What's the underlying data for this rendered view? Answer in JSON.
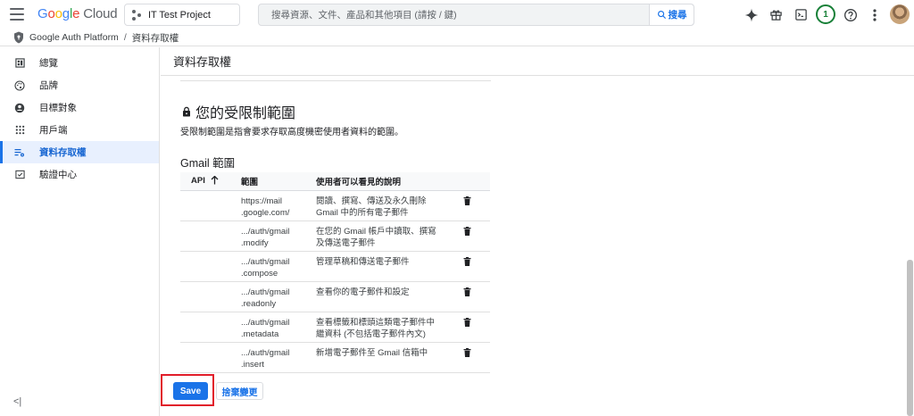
{
  "header": {
    "logo_google": [
      "G",
      "o",
      "o",
      "g",
      "l",
      "e"
    ],
    "logo_cloud": "Cloud",
    "project_name": "IT Test Project",
    "search_placeholder": "搜尋資源、文件、產品和其他項目 (請按 / 鍵)",
    "search_button": "搜尋",
    "notification_count": "1",
    "icons": [
      "menu-icon",
      "gemini-icon",
      "gift-icon",
      "cloud-shell-icon",
      "help-icon",
      "more-vert-icon"
    ]
  },
  "breadcrumb": {
    "root": "Google Auth Platform",
    "separator": "/",
    "current": "資料存取權"
  },
  "sidebar": {
    "items": [
      {
        "label": "總覽",
        "icon": "dashboard-icon"
      },
      {
        "label": "品牌",
        "icon": "palette-icon"
      },
      {
        "label": "目標對象",
        "icon": "account-circle-icon"
      },
      {
        "label": "用戶端",
        "icon": "grid-icon"
      },
      {
        "label": "資料存取權",
        "icon": "data-access-icon",
        "active": true
      },
      {
        "label": "驗證中心",
        "icon": "verify-icon"
      }
    ],
    "collapse": "<|"
  },
  "main": {
    "page_title": "資料存取權",
    "section_title": "您的受限制範圍",
    "section_desc": "受限制範圍是指會要求存取高度機密使用者資料的範圍。",
    "gmail_title": "Gmail 範圍",
    "table": {
      "headers": {
        "api": "API",
        "scope": "範圍",
        "desc": "使用者可以看見的說明"
      },
      "rows": [
        {
          "scope1": "https://mail",
          "scope2": ".google.com/",
          "desc1": "閱讀、撰寫、傳送及永久刪除",
          "desc2": "Gmail 中的所有電子郵件"
        },
        {
          "scope1": ".../auth/gmail",
          "scope2": ".modify",
          "desc1": "在您的 Gmail 帳戶中讀取、撰寫",
          "desc2": "及傳送電子郵件"
        },
        {
          "scope1": ".../auth/gmail",
          "scope2": ".compose",
          "desc1": "管理草稿和傳送電子郵件",
          "desc2": ""
        },
        {
          "scope1": ".../auth/gmail",
          "scope2": ".readonly",
          "desc1": "查看你的電子郵件和設定",
          "desc2": ""
        },
        {
          "scope1": ".../auth/gmail",
          "scope2": ".metadata",
          "desc1": "查看標籤和標頭這類電子郵件中",
          "desc2": "繼資料 (不包括電子郵件內文)"
        },
        {
          "scope1": ".../auth/gmail",
          "scope2": ".insert",
          "desc1": "新增電子郵件至 Gmail 信箱中",
          "desc2": ""
        }
      ]
    },
    "save_button": "Save",
    "discard_button": "捨棄變更"
  },
  "colors": {
    "primary": "#1a73e8",
    "active_bg": "#e8f0fe",
    "highlight": "#e11d2a"
  }
}
